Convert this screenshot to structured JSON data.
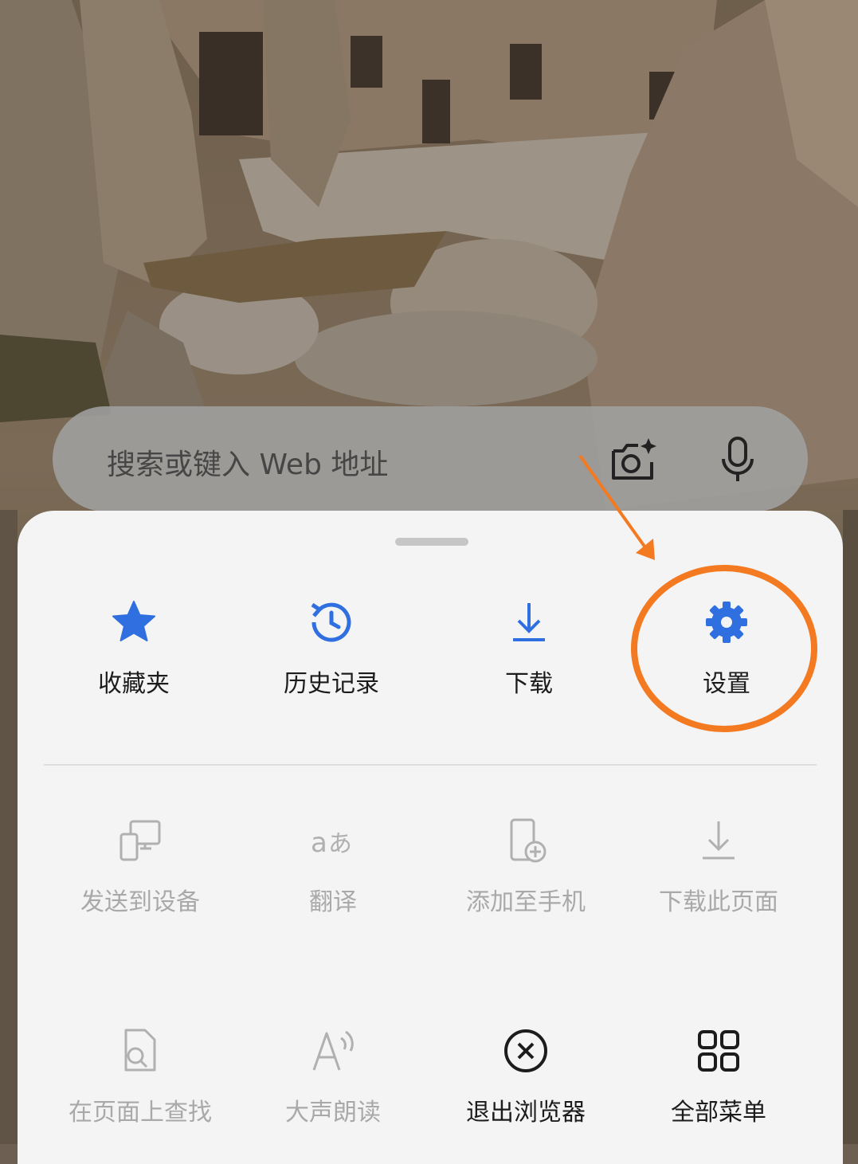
{
  "search": {
    "placeholder": "搜索或键入 Web 地址",
    "icons": [
      "camera-sparkle-icon",
      "microphone-icon"
    ]
  },
  "menu": {
    "primary": [
      {
        "label": "收藏夹",
        "icon": "star-icon"
      },
      {
        "label": "历史记录",
        "icon": "history-icon"
      },
      {
        "label": "下载",
        "icon": "download-icon"
      },
      {
        "label": "设置",
        "icon": "gear-icon"
      }
    ],
    "row2": [
      {
        "label": "发送到设备",
        "icon": "send-to-device-icon",
        "enabled": false
      },
      {
        "label": "翻译",
        "icon": "translate-icon",
        "enabled": false
      },
      {
        "label": "添加至手机",
        "icon": "add-to-phone-icon",
        "enabled": false
      },
      {
        "label": "下载此页面",
        "icon": "download-page-icon",
        "enabled": false
      }
    ],
    "row3": [
      {
        "label": "在页面上查找",
        "icon": "find-in-page-icon",
        "enabled": false
      },
      {
        "label": "大声朗读",
        "icon": "read-aloud-icon",
        "enabled": false
      },
      {
        "label": "退出浏览器",
        "icon": "exit-icon",
        "enabled": true
      },
      {
        "label": "全部菜单",
        "icon": "grid-icon",
        "enabled": true
      }
    ]
  },
  "colors": {
    "accent": "#2f6fe0",
    "annotation": "#f37a20",
    "sheet": "#f4f4f4",
    "disabled": "#a9a9a9"
  }
}
